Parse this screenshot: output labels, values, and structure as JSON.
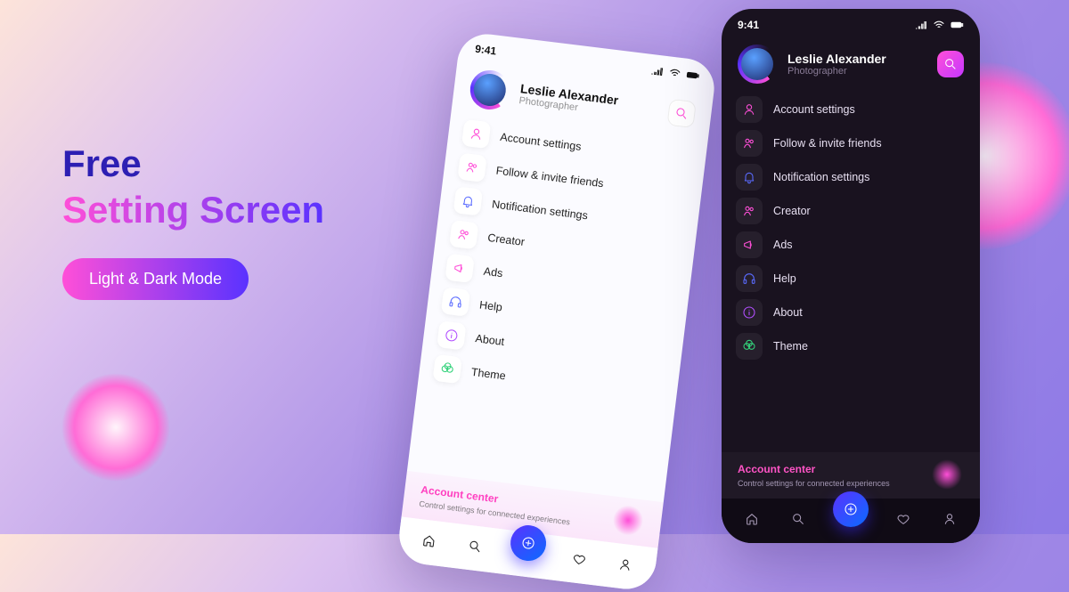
{
  "headline": {
    "line1": "Free",
    "line2": "Setting Screen"
  },
  "pill_label": "Light & Dark Mode",
  "status_time": "9:41",
  "profile": {
    "name": "Leslie Alexander",
    "role": "Photographer"
  },
  "settings": [
    {
      "label": "Account settings",
      "icon": "user-icon",
      "stroke": "#ff4fd8"
    },
    {
      "label": "Follow & invite friends",
      "icon": "users-icon",
      "stroke": "#ff4fd8"
    },
    {
      "label": "Notification settings",
      "icon": "bell-icon",
      "stroke": "#5a6bff"
    },
    {
      "label": "Creator",
      "icon": "users-icon",
      "stroke": "#ff4fd8"
    },
    {
      "label": "Ads",
      "icon": "megaphone-icon",
      "stroke": "#ff4fd8"
    },
    {
      "label": "Help",
      "icon": "headset-icon",
      "stroke": "#5a6bff"
    },
    {
      "label": "About",
      "icon": "info-icon",
      "stroke": "#b24fff"
    },
    {
      "label": "Theme",
      "icon": "palette-icon",
      "stroke": "#34d27b"
    }
  ],
  "account_center": {
    "title": "Account center",
    "subtitle": "Control settings for connected experiences"
  },
  "nav_icons": [
    "home-icon",
    "search-icon",
    "add-icon",
    "heart-icon",
    "profile-icon"
  ]
}
